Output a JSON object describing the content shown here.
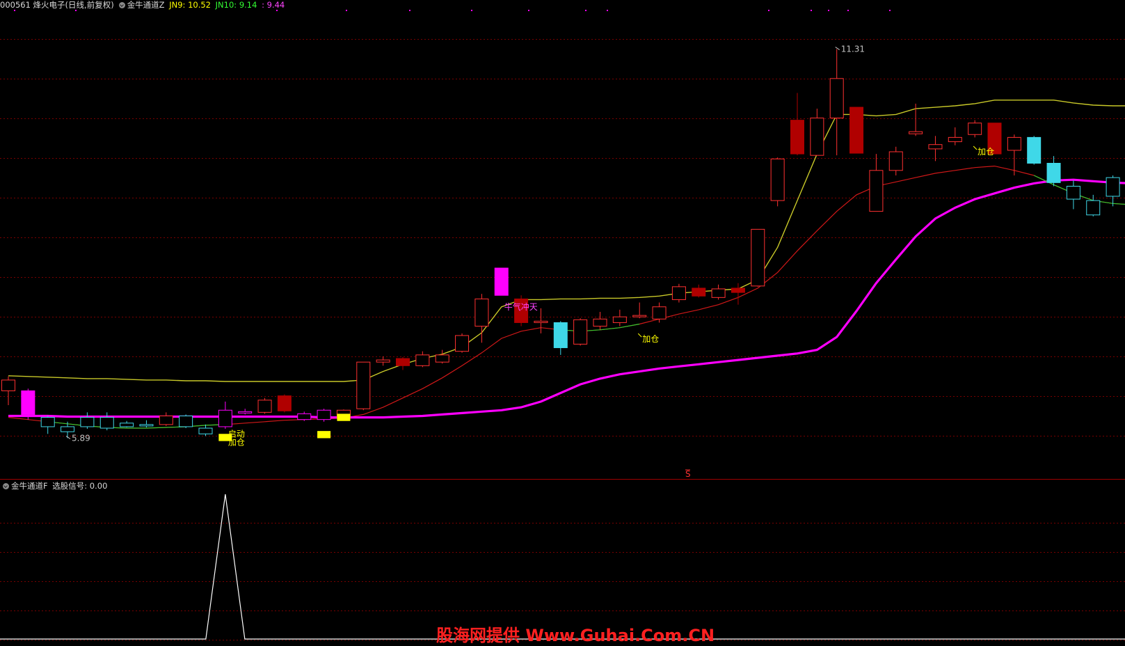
{
  "header_main": {
    "stock": "000561 烽火电子(日线,前复权)",
    "indicator": "金牛通道Z",
    "jn9_label": "JN9: 10.52",
    "jn10_label": "JN10: 9.14",
    "third_label": ": 9.44"
  },
  "header_sub": {
    "indicator": "金牛通道F",
    "signal_label": "选股信号: 0.00"
  },
  "marker_s": "S",
  "watermark": "股海网提供 Www.Guhai.Com.CN",
  "colors": {
    "bg": "#000000",
    "grid": "#7a0000",
    "separator": "#a00000",
    "up": "#ff3030",
    "down_fill": "#b00000",
    "cyan": "#3fd8e8",
    "magenta": "#ff00ff",
    "signal_yellow": "#ffff00",
    "upper_line": "#c8c828",
    "mid_line": "#d01818",
    "green_line": "#2fc82f",
    "signal_line": "#ffffff"
  },
  "chart_data": [
    {
      "type": "candlestick",
      "title": "",
      "ylim": [
        5.4,
        11.8
      ],
      "candles": [
        {
          "o": 6.55,
          "h": 6.75,
          "l": 6.35,
          "c": 6.7,
          "color": "red"
        },
        {
          "o": 6.55,
          "h": 6.58,
          "l": 6.15,
          "c": 6.22,
          "color": "magenta"
        },
        {
          "o": 6.18,
          "h": 6.2,
          "l": 5.95,
          "c": 6.05,
          "color": "cyan"
        },
        {
          "o": 6.05,
          "h": 6.12,
          "l": 5.89,
          "c": 5.98,
          "color": "cyan"
        },
        {
          "o": 6.05,
          "h": 6.25,
          "l": 6.02,
          "c": 6.18,
          "color": "cyan"
        },
        {
          "o": 6.18,
          "h": 6.25,
          "l": 6.0,
          "c": 6.03,
          "color": "cyan"
        },
        {
          "o": 6.05,
          "h": 6.13,
          "l": 6.04,
          "c": 6.1,
          "color": "cyan"
        },
        {
          "o": 6.06,
          "h": 6.14,
          "l": 6.04,
          "c": 6.08,
          "color": "cyan"
        },
        {
          "o": 6.08,
          "h": 6.25,
          "l": 6.06,
          "c": 6.2,
          "color": "red"
        },
        {
          "o": 6.2,
          "h": 6.22,
          "l": 6.03,
          "c": 6.05,
          "color": "cyan"
        },
        {
          "o": 5.95,
          "h": 6.08,
          "l": 5.92,
          "c": 6.03,
          "color": "cyan"
        },
        {
          "o": 6.05,
          "h": 6.4,
          "l": 6.02,
          "c": 6.28,
          "color": "magenta"
        },
        {
          "o": 6.24,
          "h": 6.3,
          "l": 6.22,
          "c": 6.26,
          "color": "magenta"
        },
        {
          "o": 6.25,
          "h": 6.45,
          "l": 6.23,
          "c": 6.42,
          "color": "red"
        },
        {
          "o": 6.48,
          "h": 6.5,
          "l": 6.25,
          "c": 6.27,
          "color": "darkred"
        },
        {
          "o": 6.23,
          "h": 6.26,
          "l": 6.13,
          "c": 6.15,
          "color": "magenta"
        },
        {
          "o": 6.15,
          "h": 6.3,
          "l": 6.12,
          "c": 6.28,
          "color": "magenta"
        },
        {
          "o": 6.17,
          "h": 6.29,
          "l": 6.16,
          "c": 6.28,
          "color": "red"
        },
        {
          "o": 6.3,
          "h": 6.95,
          "l": 6.28,
          "c": 6.95,
          "color": "red"
        },
        {
          "o": 6.95,
          "h": 7.03,
          "l": 6.9,
          "c": 6.98,
          "color": "red"
        },
        {
          "o": 7.0,
          "h": 7.02,
          "l": 6.84,
          "c": 6.9,
          "color": "darkred"
        },
        {
          "o": 6.9,
          "h": 7.1,
          "l": 6.88,
          "c": 7.05,
          "color": "red"
        },
        {
          "o": 6.95,
          "h": 7.12,
          "l": 6.93,
          "c": 7.05,
          "color": "red"
        },
        {
          "o": 7.1,
          "h": 7.35,
          "l": 7.08,
          "c": 7.32,
          "color": "red"
        },
        {
          "o": 7.45,
          "h": 7.9,
          "l": 7.22,
          "c": 7.83,
          "color": "red"
        },
        {
          "o": 8.26,
          "h": 8.26,
          "l": 7.88,
          "c": 7.88,
          "color": "magenta"
        },
        {
          "o": 7.83,
          "h": 7.88,
          "l": 7.45,
          "c": 7.5,
          "color": "darkred"
        },
        {
          "o": 7.52,
          "h": 7.7,
          "l": 7.35,
          "c": 7.5,
          "color": "red"
        },
        {
          "o": 7.5,
          "h": 7.52,
          "l": 7.05,
          "c": 7.15,
          "color": "cyan"
        },
        {
          "o": 7.2,
          "h": 7.56,
          "l": 7.18,
          "c": 7.54,
          "color": "red"
        },
        {
          "o": 7.45,
          "h": 7.65,
          "l": 7.4,
          "c": 7.55,
          "color": "red"
        },
        {
          "o": 7.5,
          "h": 7.68,
          "l": 7.45,
          "c": 7.58,
          "color": "red"
        },
        {
          "o": 7.58,
          "h": 7.78,
          "l": 7.56,
          "c": 7.6,
          "color": "red"
        },
        {
          "o": 7.55,
          "h": 7.78,
          "l": 7.5,
          "c": 7.72,
          "color": "red"
        },
        {
          "o": 7.82,
          "h": 8.04,
          "l": 7.78,
          "c": 8.0,
          "color": "red"
        },
        {
          "o": 7.98,
          "h": 8.03,
          "l": 7.85,
          "c": 7.87,
          "color": "darkred"
        },
        {
          "o": 7.85,
          "h": 8.03,
          "l": 7.82,
          "c": 7.97,
          "color": "red"
        },
        {
          "o": 7.98,
          "h": 8.05,
          "l": 7.75,
          "c": 7.92,
          "color": "darkred"
        },
        {
          "o": 8.01,
          "h": 8.8,
          "l": 8.0,
          "c": 8.8,
          "color": "red"
        },
        {
          "o": 9.2,
          "h": 9.8,
          "l": 9.12,
          "c": 9.78,
          "color": "red"
        },
        {
          "o": 10.32,
          "h": 10.7,
          "l": 9.83,
          "c": 9.85,
          "color": "darkred"
        },
        {
          "o": 9.83,
          "h": 10.48,
          "l": 9.83,
          "c": 10.35,
          "color": "red"
        },
        {
          "o": 10.35,
          "h": 11.31,
          "l": 9.83,
          "c": 10.9,
          "color": "red"
        },
        {
          "o": 10.5,
          "h": 10.5,
          "l": 9.86,
          "c": 9.86,
          "color": "darkred"
        },
        {
          "o": 9.05,
          "h": 9.85,
          "l": 9.05,
          "c": 9.62,
          "color": "red"
        },
        {
          "o": 9.62,
          "h": 9.95,
          "l": 9.55,
          "c": 9.88,
          "color": "red"
        },
        {
          "o": 10.13,
          "h": 10.55,
          "l": 10.1,
          "c": 10.16,
          "color": "red"
        },
        {
          "o": 9.92,
          "h": 10.1,
          "l": 9.75,
          "c": 9.98,
          "color": "red"
        },
        {
          "o": 10.02,
          "h": 10.22,
          "l": 9.97,
          "c": 10.08,
          "color": "red"
        },
        {
          "o": 10.12,
          "h": 10.32,
          "l": 10.08,
          "c": 10.28,
          "color": "red"
        },
        {
          "o": 10.28,
          "h": 10.28,
          "l": 9.85,
          "c": 9.85,
          "color": "darkred"
        },
        {
          "o": 9.9,
          "h": 10.12,
          "l": 9.55,
          "c": 10.08,
          "color": "red"
        },
        {
          "o": 10.08,
          "h": 10.1,
          "l": 9.7,
          "c": 9.72,
          "color": "cyan"
        },
        {
          "o": 9.72,
          "h": 9.82,
          "l": 9.4,
          "c": 9.45,
          "color": "cyan"
        },
        {
          "o": 9.4,
          "h": 9.48,
          "l": 9.08,
          "c": 9.22,
          "color": "cyan"
        },
        {
          "o": 9.2,
          "h": 9.28,
          "l": 8.98,
          "c": 9.0,
          "color": "cyan"
        },
        {
          "o": 9.26,
          "h": 9.55,
          "l": 9.12,
          "c": 9.52,
          "color": "cyan"
        },
        {
          "o": 9.52,
          "h": 9.56,
          "l": 9.3,
          "c": 9.38,
          "color": "cyan"
        }
      ],
      "series": [
        {
          "name": "JN9",
          "values": [
            6.76,
            6.75,
            6.74,
            6.73,
            6.72,
            6.72,
            6.71,
            6.7,
            6.7,
            6.69,
            6.69,
            6.68,
            6.68,
            6.68,
            6.68,
            6.68,
            6.68,
            6.68,
            6.7,
            6.82,
            6.92,
            7.0,
            7.06,
            7.16,
            7.36,
            7.72,
            7.82,
            7.82,
            7.83,
            7.83,
            7.84,
            7.84,
            7.85,
            7.87,
            7.91,
            7.93,
            7.95,
            7.97,
            8.1,
            8.55,
            9.2,
            9.85,
            10.4,
            10.4,
            10.38,
            10.4,
            10.48,
            10.5,
            10.52,
            10.55,
            10.6,
            10.6,
            10.6,
            10.6,
            10.56,
            10.53,
            10.52,
            10.52
          ]
        },
        {
          "name": "JN10",
          "values": [
            6.18,
            6.15,
            6.12,
            6.09,
            6.06,
            6.04,
            6.03,
            6.03,
            6.04,
            6.05,
            6.07,
            6.08,
            6.1,
            6.12,
            6.14,
            6.15,
            6.16,
            6.17,
            6.22,
            6.32,
            6.45,
            6.58,
            6.73,
            6.9,
            7.08,
            7.28,
            7.38,
            7.43,
            7.4,
            7.38,
            7.4,
            7.43,
            7.48,
            7.55,
            7.62,
            7.68,
            7.75,
            7.85,
            7.98,
            8.2,
            8.5,
            8.78,
            9.05,
            9.28,
            9.4,
            9.46,
            9.52,
            9.58,
            9.62,
            9.66,
            9.68,
            9.62,
            9.55,
            9.42,
            9.3,
            9.2,
            9.16,
            9.14
          ]
        },
        {
          "name": "",
          "values": [
            6.2,
            6.2,
            6.2,
            6.19,
            6.19,
            6.19,
            6.19,
            6.19,
            6.19,
            6.19,
            6.19,
            6.19,
            6.19,
            6.19,
            6.19,
            6.19,
            6.18,
            6.18,
            6.18,
            6.18,
            6.19,
            6.2,
            6.22,
            6.24,
            6.26,
            6.28,
            6.32,
            6.4,
            6.52,
            6.64,
            6.72,
            6.78,
            6.82,
            6.86,
            6.89,
            6.92,
            6.95,
            6.98,
            7.01,
            7.04,
            7.07,
            7.12,
            7.3,
            7.66,
            8.05,
            8.38,
            8.7,
            8.95,
            9.1,
            9.22,
            9.3,
            9.38,
            9.44,
            9.48,
            9.49,
            9.47,
            9.45,
            9.44
          ]
        }
      ],
      "annotations": [
        {
          "text": "5.89",
          "index": 3,
          "price": 5.89
        },
        {
          "text": "11.31",
          "index": 42,
          "price": 11.31
        },
        {
          "text": "启动",
          "index": 11,
          "price": 5.95
        },
        {
          "text": "加仓",
          "index": 11,
          "price": 5.83
        },
        {
          "text": "牛气冲天",
          "index": 25,
          "price": 7.72
        },
        {
          "text": "加仓",
          "index": 32,
          "price": 7.27
        },
        {
          "text": "加仓",
          "index": 49,
          "price": 9.88
        }
      ],
      "signal_blocks": [
        {
          "index": 16,
          "price_top": 5.99,
          "price_bottom": 5.89
        },
        {
          "index": 17,
          "price_top": 6.23,
          "price_bottom": 6.13
        },
        {
          "index": 11,
          "price_top": 5.95,
          "price_bottom": 5.85
        }
      ]
    },
    {
      "type": "line",
      "title": "",
      "ylim": [
        0,
        1
      ],
      "series": [
        {
          "name": "选股信号",
          "values": [
            0,
            0,
            0,
            0,
            0,
            0,
            0,
            0,
            0,
            0,
            0,
            1,
            0,
            0,
            0,
            0,
            0,
            0,
            0,
            0,
            0,
            0,
            0,
            0,
            0,
            0,
            0,
            0,
            0,
            0,
            0,
            0,
            0,
            0,
            0,
            0,
            0,
            0,
            0,
            0,
            0,
            0,
            0,
            0,
            0,
            0,
            0,
            0,
            0,
            0,
            0,
            0,
            0,
            0,
            0,
            0,
            0,
            0
          ]
        }
      ]
    }
  ]
}
